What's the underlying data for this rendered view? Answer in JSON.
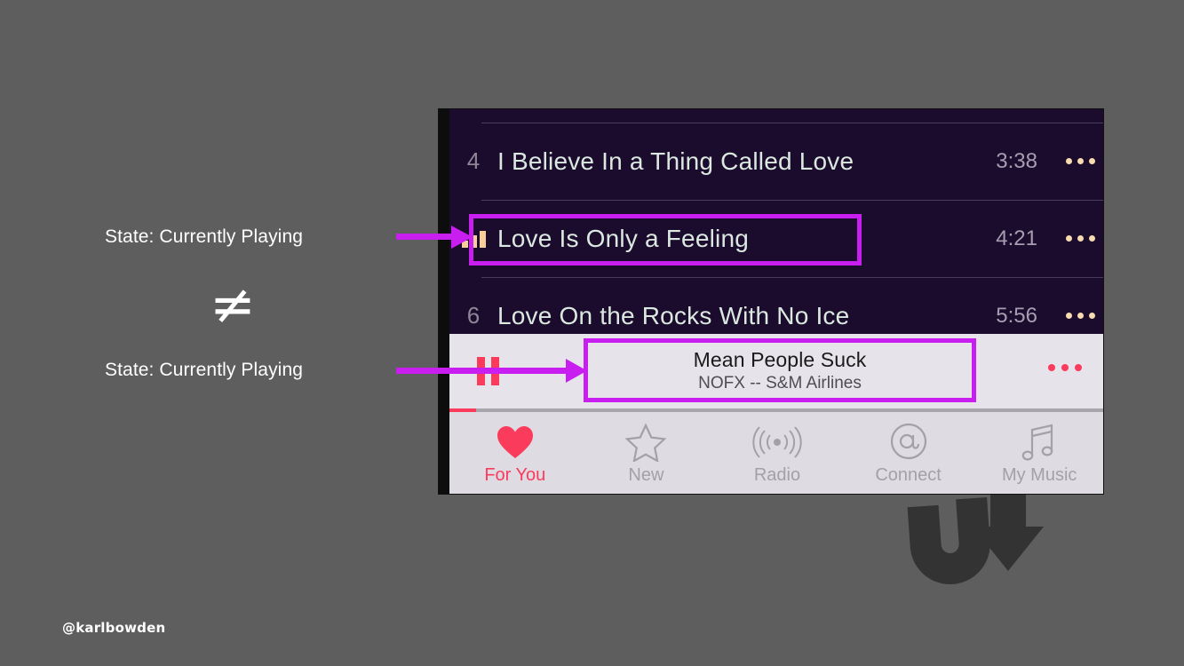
{
  "annotations": {
    "top_label": "State: Currently Playing",
    "bottom_label": "State: Currently Playing",
    "not_equal_symbol": "≠",
    "handle": "@karlbowden",
    "highlight_color": "#c81ff0",
    "arrow_color": "#c81ff0",
    "canvas_background": "#5e5e5e"
  },
  "phone": {
    "screen_background": "#1b0c2e",
    "tracklist": [
      {
        "number": "4",
        "title": "I Believe In a Thing Called Love",
        "duration": "3:38",
        "playing": false,
        "menu": "more-options"
      },
      {
        "number": "",
        "title": "Love Is Only a Feeling",
        "duration": "4:21",
        "playing": true,
        "menu": "more-options"
      },
      {
        "number": "6",
        "title": "Love On the Rocks With No Ice",
        "duration": "5:56",
        "playing": false,
        "menu": "more-options"
      }
    ],
    "now_playing": {
      "title": "Mean People Suck",
      "subtitle": "NOFX -- S&M Airlines",
      "transport_state": "pause",
      "transport_icon": "pause-icon",
      "menu": "more-options",
      "progress_percent": 4,
      "accent_color": "#fb3b5c"
    },
    "tabbar": [
      {
        "label": "For You",
        "icon": "heart-icon",
        "active": true
      },
      {
        "label": "New",
        "icon": "star-icon",
        "active": false
      },
      {
        "label": "Radio",
        "icon": "broadcast-icon",
        "active": false
      },
      {
        "label": "Connect",
        "icon": "at-sign-icon",
        "active": false
      },
      {
        "label": "My Music",
        "icon": "music-note-icon",
        "active": false
      }
    ]
  }
}
